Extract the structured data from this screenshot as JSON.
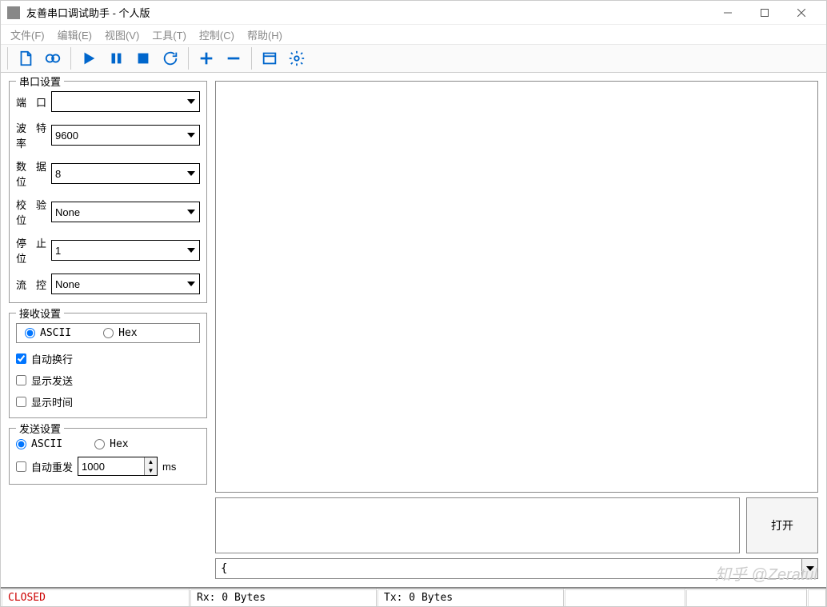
{
  "title": "友善串口调试助手 - 个人版",
  "menu": {
    "file": "文件(F)",
    "edit": "编辑(E)",
    "view": "视图(V)",
    "tools": "工具(T)",
    "control": "控制(C)",
    "help": "帮助(H)"
  },
  "serial_settings": {
    "title": "串口设置",
    "port_label": "端 口",
    "port_value": "",
    "baud_label": "波特率",
    "baud_value": "9600",
    "data_label": "数据位",
    "data_value": "8",
    "parity_label": "校验位",
    "parity_value": "None",
    "stop_label": "停止位",
    "stop_value": "1",
    "flow_label": "流 控",
    "flow_value": "None"
  },
  "receive_settings": {
    "title": "接收设置",
    "ascii": "ASCII",
    "hex": "Hex",
    "auto_wrap": "自动换行",
    "show_send": "显示发送",
    "show_time": "显示时间"
  },
  "send_settings": {
    "title": "发送设置",
    "ascii": "ASCII",
    "hex": "Hex",
    "auto_resend": "自动重发",
    "interval": "1000",
    "unit": "ms"
  },
  "open_button": "打开",
  "history_value": "{",
  "status": {
    "closed": "CLOSED",
    "rx": "Rx: 0 Bytes",
    "tx": "Tx: 0 Bytes"
  },
  "watermark": "知乎 @Zeratul"
}
